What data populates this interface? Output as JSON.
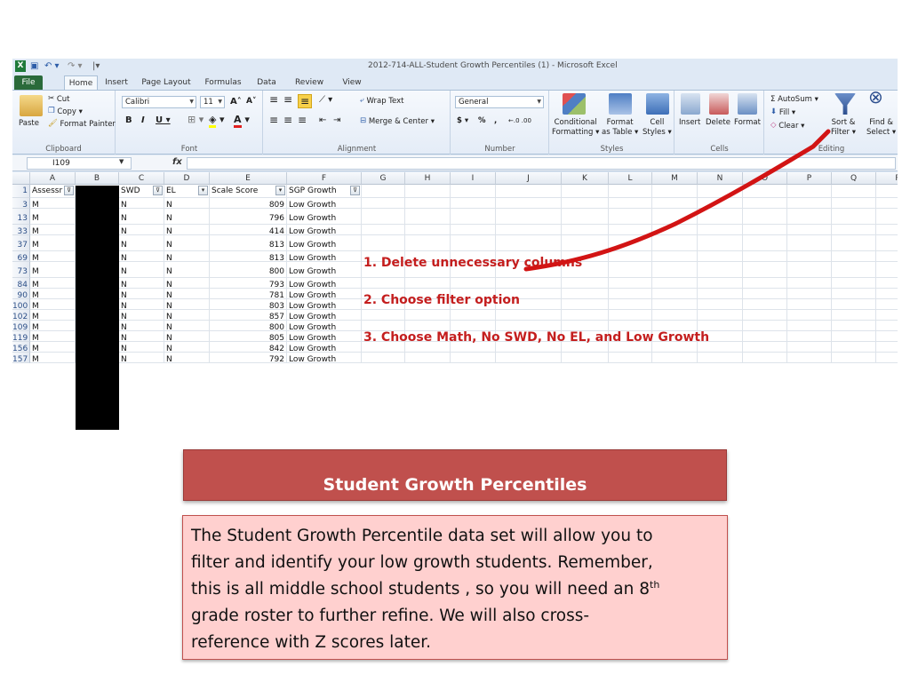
{
  "excel": {
    "window_title": "2012-714-ALL-Student Growth Percentiles (1)  -  Microsoft Excel",
    "quick_access": {
      "app_icon": "X",
      "save_glyph": "▣",
      "undo_glyph": "↶ ▾",
      "redo_glyph": "↷ ▾",
      "customize_glyph": "|▾"
    },
    "tabs": [
      "File",
      "Home",
      "Insert",
      "Page Layout",
      "Formulas",
      "Data",
      "Review",
      "View"
    ],
    "ribbon": {
      "clipboard": {
        "label": "Clipboard",
        "paste": "Paste",
        "cut": "Cut",
        "copy": "Copy ▾",
        "format_painter": "Format Painter"
      },
      "font": {
        "label": "Font",
        "font_name": "Calibri",
        "font_size": "11",
        "grow": "A˄",
        "shrink": "A˅",
        "bold": "B",
        "italic": "I",
        "underline": "U ▾"
      },
      "alignment": {
        "label": "Alignment",
        "wrap_text": "Wrap Text",
        "merge_center": "Merge & Center ▾"
      },
      "number": {
        "label": "Number",
        "format": "General",
        "currency": "$ ▾",
        "percent": "%",
        "comma": ",",
        "inc_dec": "←.0 .00",
        "dec_dec": ".00 →.0"
      },
      "styles": {
        "label": "Styles",
        "conditional_1": "Conditional",
        "conditional_2": "Formatting ▾",
        "format_table_1": "Format",
        "format_table_2": "as Table ▾",
        "cell_styles_1": "Cell",
        "cell_styles_2": "Styles ▾"
      },
      "cells": {
        "label": "Cells",
        "insert": "Insert",
        "delete": "Delete",
        "format": "Format",
        "caret": "▾"
      },
      "editing": {
        "label": "Editing",
        "autosum": "Σ AutoSum ▾",
        "fill": "Fill ▾",
        "clear": "Clear ▾",
        "sort_filter_1": "Sort &",
        "sort_filter_2": "Filter ▾",
        "find_select_1": "Find &",
        "find_select_2": "Select ▾"
      }
    },
    "name_box": "I109",
    "fx": "fx",
    "columns": [
      "A",
      "B",
      "C",
      "D",
      "E",
      "F",
      "G",
      "H",
      "I",
      "J",
      "K",
      "L",
      "M",
      "N",
      "O",
      "P",
      "Q",
      "R"
    ],
    "header_row": {
      "row": "1",
      "a": "Assessr",
      "c": "SWD",
      "d": "EL",
      "e": "Scale Score",
      "f": "SGP Growth"
    },
    "rows": [
      {
        "row": "3",
        "a": "M",
        "c": "N",
        "d": "N",
        "e": "809",
        "f": "Low Growth"
      },
      {
        "row": "13",
        "a": "M",
        "c": "N",
        "d": "N",
        "e": "796",
        "f": "Low Growth"
      },
      {
        "row": "33",
        "a": "M",
        "c": "N",
        "d": "N",
        "e": "414",
        "f": "Low Growth"
      },
      {
        "row": "37",
        "a": "M",
        "c": "N",
        "d": "N",
        "e": "813",
        "f": "Low Growth"
      },
      {
        "row": "69",
        "a": "M",
        "c": "N",
        "d": "N",
        "e": "813",
        "f": "Low Growth"
      },
      {
        "row": "73",
        "a": "M",
        "c": "N",
        "d": "N",
        "e": "800",
        "f": "Low Growth"
      },
      {
        "row": "84",
        "a": "M",
        "c": "N",
        "d": "N",
        "e": "793",
        "f": "Low Growth"
      },
      {
        "row": "90",
        "a": "M",
        "c": "N",
        "d": "N",
        "e": "781",
        "f": "Low Growth"
      },
      {
        "row": "100",
        "a": "M",
        "c": "N",
        "d": "N",
        "e": "803",
        "f": "Low Growth"
      },
      {
        "row": "102",
        "a": "M",
        "c": "N",
        "d": "N",
        "e": "857",
        "f": "Low Growth"
      },
      {
        "row": "109",
        "a": "M",
        "c": "N",
        "d": "N",
        "e": "800",
        "f": "Low Growth"
      },
      {
        "row": "119",
        "a": "M",
        "c": "N",
        "d": "N",
        "e": "805",
        "f": "Low Growth"
      },
      {
        "row": "156",
        "a": "M",
        "c": "N",
        "d": "N",
        "e": "842",
        "f": "Low Growth"
      },
      {
        "row": "157",
        "a": "M",
        "c": "N",
        "d": "N",
        "e": "792",
        "f": "Low Growth"
      }
    ],
    "annotations": [
      "1.  Delete unnecessary columns",
      "2.  Choose filter option",
      "3.  Choose Math, No SWD, No EL, and Low Growth"
    ]
  },
  "slide": {
    "heading": "Student Growth Percentiles",
    "body_line1": "The Student Growth Percentile data set will allow you to",
    "body_line2": "filter and identify your low growth students.  Remember,",
    "body_line3_pre": "this is all middle school students , so you will need an 8",
    "body_line3_sup": "th",
    "body_line4": "grade roster to further refine.  We will also cross-",
    "body_line5": "reference with Z  scores later."
  },
  "colors": {
    "accent_red": "#c41e1e",
    "heading_bg": "#c0504d",
    "body_bg": "#ffd0cf"
  }
}
